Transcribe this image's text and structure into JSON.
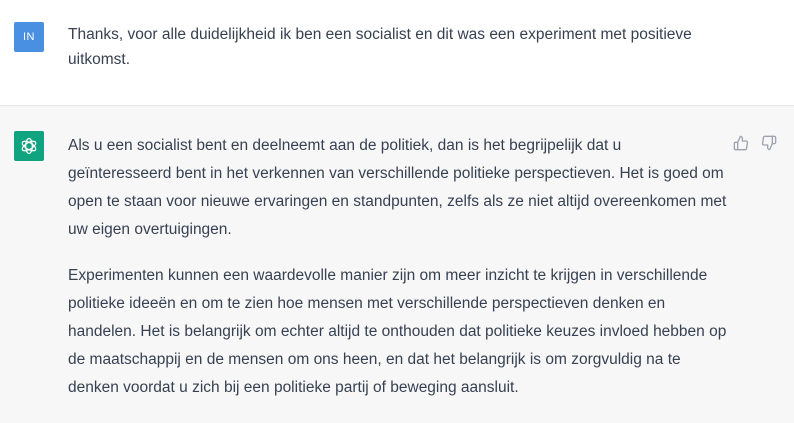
{
  "user": {
    "avatar_initials": "IN",
    "avatar_color": "#4a90e2",
    "message": "Thanks, voor alle duidelijkheid ik ben een socialist en dit was een experiment met positieve uitkomst."
  },
  "assistant": {
    "avatar_icon": "openai-logo-icon",
    "avatar_color": "#10a37f",
    "paragraphs": [
      "Als u een socialist bent en deelneemt aan de politiek, dan is het begrijpelijk dat u geïnteresseerd bent in het verkennen van verschillende politieke perspectieven. Het is goed om open te staan voor nieuwe ervaringen en standpunten, zelfs als ze niet altijd overeenkomen met uw eigen overtuigingen.",
      "Experimenten kunnen een waardevolle manier zijn om meer inzicht te krijgen in verschillende politieke ideeën en om te zien hoe mensen met verschillende perspectieven denken en handelen. Het is belangrijk om echter altijd te onthouden dat politieke keuzes invloed hebben op de maatschappij en de mensen om ons heen, en dat het belangrijk is om zorgvuldig na te denken voordat u zich bij een politieke partij of beweging aansluit."
    ],
    "feedback": {
      "thumbs_up_icon": "thumbs-up-icon",
      "thumbs_down_icon": "thumbs-down-icon"
    }
  }
}
